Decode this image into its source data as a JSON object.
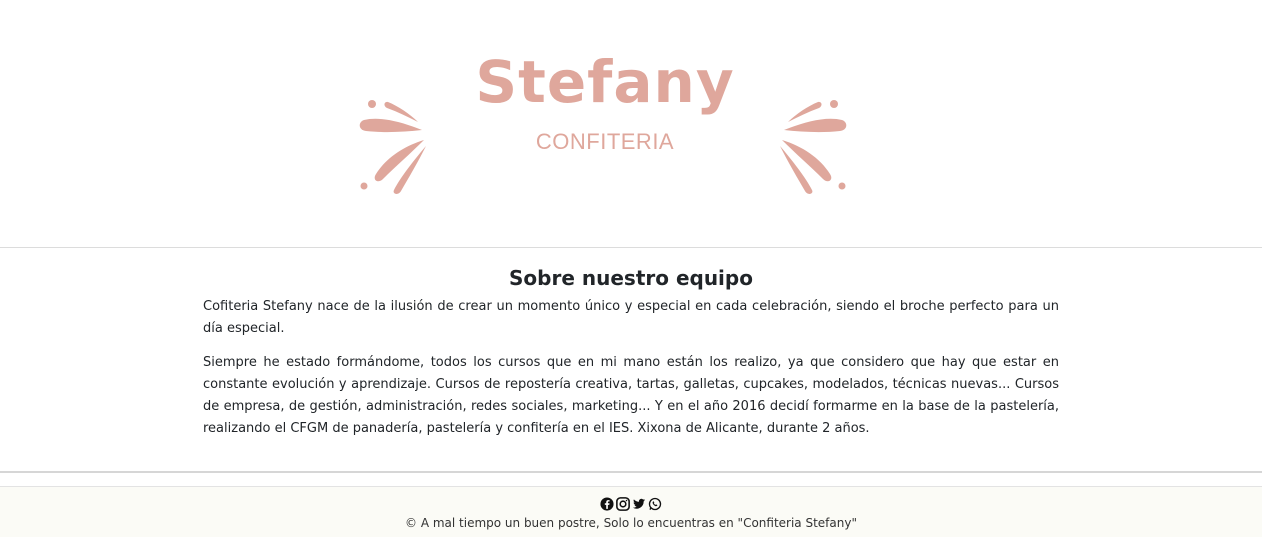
{
  "brand": {
    "name": "Stefany",
    "subtitle": "CONFITERIA",
    "color": "#dfa79c"
  },
  "about": {
    "title": "Sobre nuestro equipo",
    "paragraph1": "Cofiteria Stefany nace de la ilusión de crear un momento único y especial en cada celebración, siendo el broche perfecto para un día especial.",
    "paragraph2": "Siempre he estado formándome, todos los cursos que en mi mano están los realizo, ya que considero que hay que estar en constante evolución y aprendizaje. Cursos de repostería creativa, tartas, galletas, cupcakes, modelados, técnicas nuevas... Cursos de empresa, de gestión, administración, redes sociales, marketing... Y en el año 2016 decidí formarme en la base de la pastelería, realizando el CFGM de panadería, pastelería y confitería en el IES. Xixona de Alicante, durante 2 años."
  },
  "footer": {
    "social_icons": [
      "facebook-icon",
      "instagram-icon",
      "twitter-icon",
      "whatsapp-icon"
    ],
    "copyright": "© A mal tiempo un buen postre, Solo lo encuentras en \"Confiteria Stefany\""
  }
}
